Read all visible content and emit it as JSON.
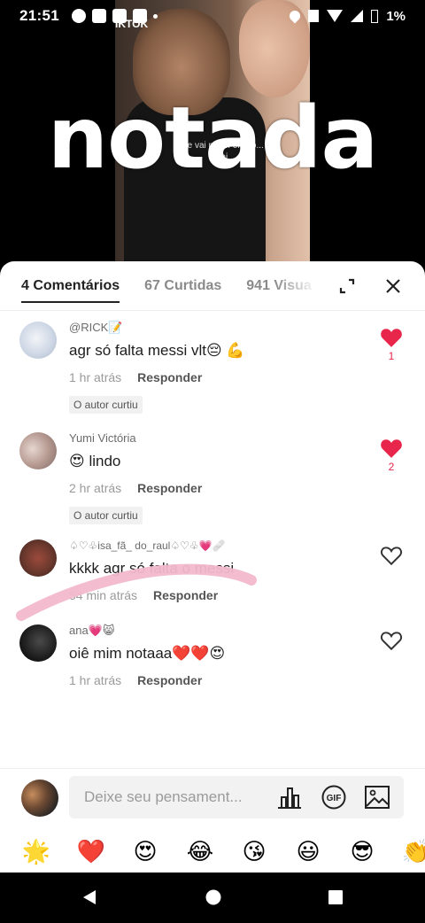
{
  "status_bar": {
    "time": "21:51",
    "battery": "1%"
  },
  "video": {
    "username": "IKTOK",
    "overlay_text": "notada",
    "caption": "ele vai mal... ele só... e vai..."
  },
  "tabs": [
    {
      "label": "4 Comentários",
      "active": true
    },
    {
      "label": "67 Curtidas",
      "active": false
    },
    {
      "label": "941 Visua",
      "active": false
    }
  ],
  "comments": [
    {
      "name": "@RICK📝",
      "text": "agr só falta messi vlt😔 💪",
      "time": "1 hr atrás",
      "reply": "Responder",
      "badge": "O autor curtiu",
      "liked": true,
      "likes": "1"
    },
    {
      "name": "Yumi Victória",
      "text": "😍 lindo",
      "time": "2 hr atrás",
      "reply": "Responder",
      "badge": "O autor curtiu",
      "liked": true,
      "likes": "2"
    },
    {
      "name": "♤♡♧isa_fã_ do_raul♤♡♧💗🩹",
      "text": "kkkk agr só falta o messi",
      "time": "54 min atrás",
      "reply": "Responder",
      "badge": "",
      "liked": false,
      "likes": ""
    },
    {
      "name": "ana💗😸",
      "text": "oiê mim notaaa❤️❤️😍",
      "time": "1 hr atrás",
      "reply": "Responder",
      "badge": "",
      "liked": false,
      "likes": ""
    }
  ],
  "input": {
    "placeholder": "Deixe seu pensament..."
  },
  "emoji_bar": [
    "🌟",
    "❤️",
    "😍",
    "😂",
    "😘",
    "😃",
    "😎",
    "👏"
  ],
  "colors": {
    "like_red": "#e8254a",
    "pink_stroke": "#f2b8cc"
  },
  "icons": [
    "expand-icon",
    "close-icon",
    "heart-icon",
    "chart-icon",
    "gif-icon",
    "image-icon",
    "back-icon",
    "home-icon",
    "recents-icon"
  ]
}
